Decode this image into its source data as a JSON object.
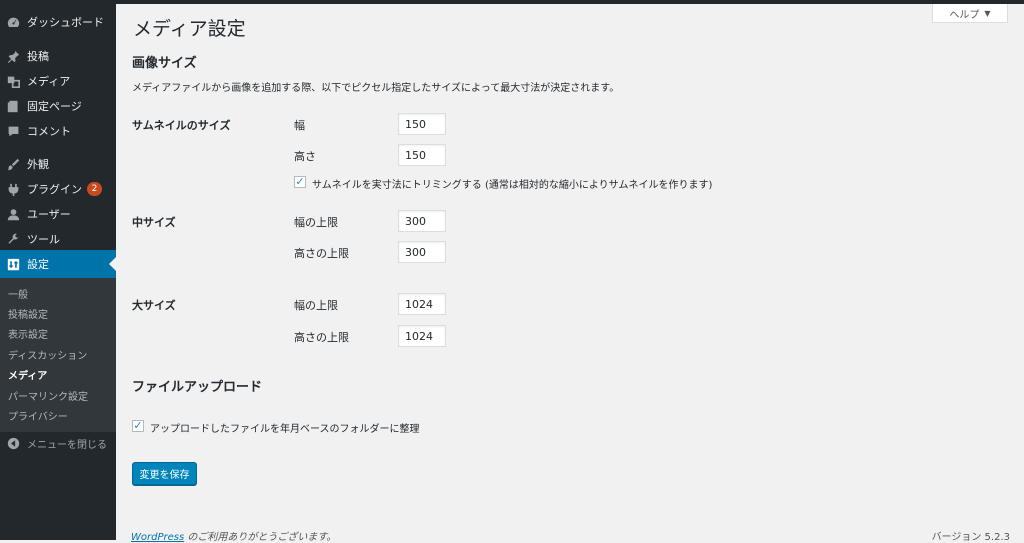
{
  "sidebar": {
    "items": [
      {
        "label": "ダッシュボード",
        "icon": "dashboard-icon"
      },
      {
        "label": "投稿",
        "icon": "pin-icon"
      },
      {
        "label": "メディア",
        "icon": "media-icon"
      },
      {
        "label": "固定ページ",
        "icon": "page-icon"
      },
      {
        "label": "コメント",
        "icon": "comment-icon"
      },
      {
        "label": "外観",
        "icon": "appearance-icon"
      },
      {
        "label": "プラグイン",
        "icon": "plugin-icon",
        "badge": "2"
      },
      {
        "label": "ユーザー",
        "icon": "user-icon"
      },
      {
        "label": "ツール",
        "icon": "tools-icon"
      },
      {
        "label": "設定",
        "icon": "settings-icon"
      }
    ],
    "submenu": [
      "一般",
      "投稿設定",
      "表示設定",
      "ディスカッション",
      "メディア",
      "パーマリンク設定",
      "プライバシー"
    ],
    "collapse_label": "メニューを閉じる"
  },
  "help_label": "ヘルプ",
  "page_title": "メディア設定",
  "image_sizes": {
    "heading": "画像サイズ",
    "description": "メディアファイルから画像を追加する際、以下でピクセル指定したサイズによって最大寸法が決定されます。",
    "thumbnail": {
      "label": "サムネイルのサイズ",
      "width_label": "幅",
      "width_value": "150",
      "height_label": "高さ",
      "height_value": "150",
      "crop_label": "サムネイルを実寸法にトリミングする (通常は相対的な縮小によりサムネイルを作ります)",
      "crop_checked": true
    },
    "medium": {
      "label": "中サイズ",
      "max_width_label": "幅の上限",
      "max_width_value": "300",
      "max_height_label": "高さの上限",
      "max_height_value": "300"
    },
    "large": {
      "label": "大サイズ",
      "max_width_label": "幅の上限",
      "max_width_value": "1024",
      "max_height_label": "高さの上限",
      "max_height_value": "1024"
    }
  },
  "uploads": {
    "heading": "ファイルアップロード",
    "organize_label": "アップロードしたファイルを年月ベースのフォルダーに整理",
    "organize_checked": true
  },
  "save_label": "変更を保存",
  "footer": {
    "link_text": "WordPress",
    "thanks_text": " のご利用ありがとうございます。",
    "version": "バージョン 5.2.3"
  },
  "colors": {
    "sidebar_bg": "#23282d",
    "accent": "#0073aa",
    "primary_button": "#0085ba",
    "badge": "#ca4a1f"
  }
}
